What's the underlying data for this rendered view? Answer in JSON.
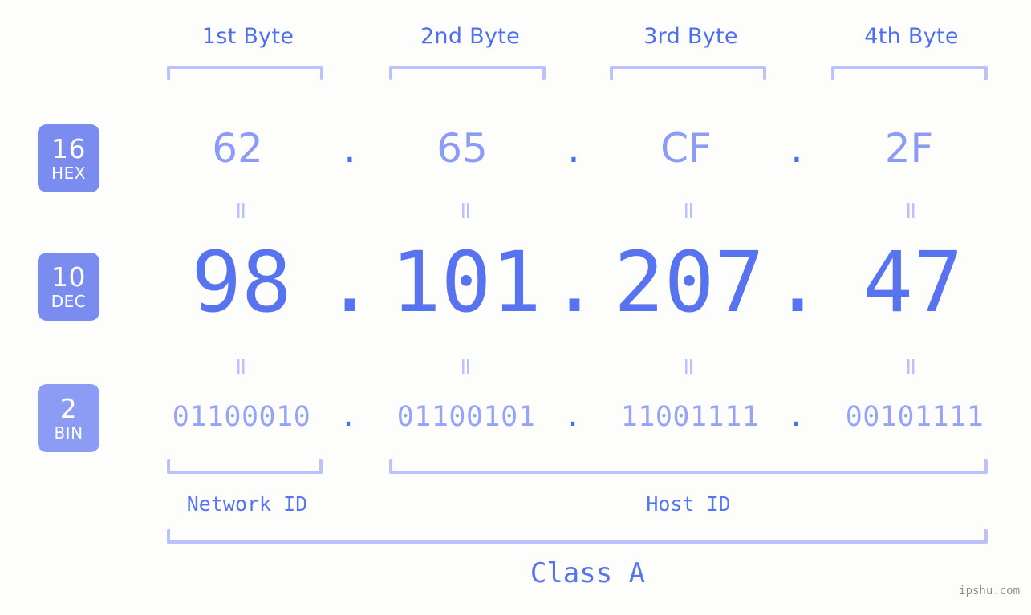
{
  "page": {
    "background_color": "#fdfefb",
    "accent_color": "#4d6ef0",
    "accent_light_color": "#b9c2fb",
    "badge_color": "#7b8cf0",
    "watermark": "ipshu.com"
  },
  "byte_headers": [
    {
      "label": "1st Byte"
    },
    {
      "label": "2nd Byte"
    },
    {
      "label": "3rd Byte"
    },
    {
      "label": "4th Byte"
    }
  ],
  "rows": {
    "hex": {
      "badge_num": "16",
      "badge_name": "HEX",
      "values": [
        "62",
        "65",
        "CF",
        "2F"
      ],
      "separator": "."
    },
    "dec": {
      "badge_num": "10",
      "badge_name": "DEC",
      "values": [
        "98",
        "101",
        "207",
        "47"
      ],
      "separator": "."
    },
    "bin": {
      "badge_num": "2",
      "badge_name": "BIN",
      "values": [
        "01100010",
        "01100101",
        "11001111",
        "00101111"
      ],
      "separator": "."
    }
  },
  "equals_marks": [
    "=",
    "=",
    "=",
    "=",
    "=",
    "=",
    "=",
    "="
  ],
  "segments": {
    "network_id": "Network ID",
    "host_id": "Host ID",
    "class": "Class A"
  }
}
